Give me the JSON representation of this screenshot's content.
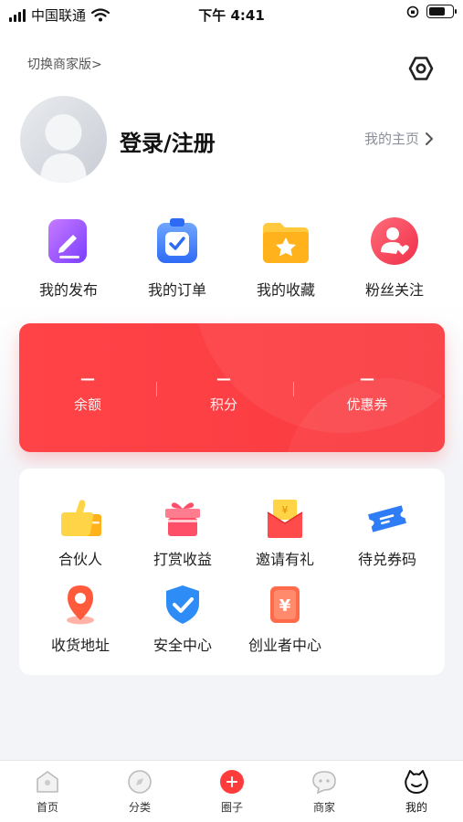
{
  "status_bar": {
    "carrier": "中国联通",
    "time": "下午 4:41"
  },
  "header": {
    "switch_label": "切换商家版>",
    "login_label": "登录/注册",
    "homepage_label": "我的主页"
  },
  "quick_actions": [
    {
      "label": "我的发布",
      "icon": "edit-document-icon"
    },
    {
      "label": "我的订单",
      "icon": "clipboard-check-icon"
    },
    {
      "label": "我的收藏",
      "icon": "folder-star-icon"
    },
    {
      "label": "粉丝关注",
      "icon": "user-heart-icon"
    }
  ],
  "wallet": {
    "items": [
      {
        "value": "—",
        "label": "余额"
      },
      {
        "value": "—",
        "label": "积分"
      },
      {
        "value": "—",
        "label": "优惠券"
      }
    ],
    "color": "#ff4347"
  },
  "services": [
    {
      "label": "合伙人",
      "icon": "thumbs-up-icon"
    },
    {
      "label": "打赏收益",
      "icon": "gift-icon"
    },
    {
      "label": "邀请有礼",
      "icon": "red-envelope-icon"
    },
    {
      "label": "待兑券码",
      "icon": "ticket-icon"
    },
    {
      "label": "收货地址",
      "icon": "location-pin-icon"
    },
    {
      "label": "安全中心",
      "icon": "shield-check-icon"
    },
    {
      "label": "创业者中心",
      "icon": "money-card-icon"
    }
  ],
  "tab_bar": [
    {
      "label": "首页",
      "icon": "home-icon"
    },
    {
      "label": "分类",
      "icon": "compass-icon"
    },
    {
      "label": "圈子",
      "icon": "plus-circle-icon"
    },
    {
      "label": "商家",
      "icon": "chat-bubble-icon"
    },
    {
      "label": "我的",
      "icon": "face-icon",
      "active": true
    }
  ]
}
